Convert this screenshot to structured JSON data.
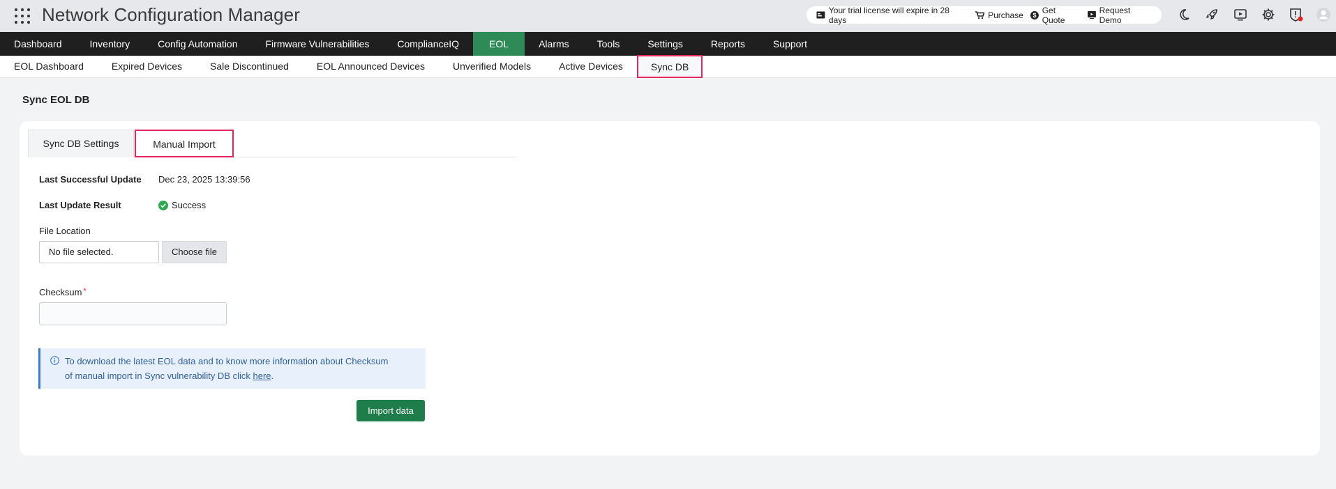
{
  "app": {
    "title": "Network Configuration Manager"
  },
  "header": {
    "trial_text": "Your trial license will expire in 28 days",
    "purchase": "Purchase",
    "get_quote": "Get Quote",
    "request_demo": "Request Demo",
    "icons": [
      "apps-grid-icon",
      "moon-icon",
      "rocket-icon",
      "video-icon",
      "gear-icon",
      "alert-shield-icon",
      "user-avatar-icon"
    ]
  },
  "mainnav": {
    "items": [
      "Dashboard",
      "Inventory",
      "Config Automation",
      "Firmware Vulnerabilities",
      "ComplianceIQ",
      "EOL",
      "Alarms",
      "Tools",
      "Settings",
      "Reports",
      "Support"
    ],
    "active": "EOL"
  },
  "subnav": {
    "items": [
      "EOL Dashboard",
      "Expired Devices",
      "Sale Discontinued",
      "EOL Announced Devices",
      "Unverified Models",
      "Active Devices",
      "Sync DB"
    ],
    "active": "Sync DB"
  },
  "page": {
    "title": "Sync EOL DB"
  },
  "tabs": {
    "sync_settings": "Sync DB Settings",
    "manual_import": "Manual Import",
    "active": "Manual Import"
  },
  "status": {
    "last_update_label": "Last Successful Update",
    "last_update_value": "Dec 23, 2025 13:39:56",
    "last_result_label": "Last Update Result",
    "last_result_value": "Success"
  },
  "file": {
    "label": "File Location",
    "value": "No file selected.",
    "button": "Choose file"
  },
  "checksum": {
    "label": "Checksum",
    "required_mark": "*",
    "value": ""
  },
  "info": {
    "line1": "To download the latest EOL data and to know more information about Checksum",
    "line2": "of manual import in Sync vulnerability DB click ",
    "link": "here",
    "end": "."
  },
  "actions": {
    "import": "Import data"
  },
  "colors": {
    "accent_green": "#2e8b57",
    "highlight_border": "#e6245e",
    "success": "#2fa84f",
    "info_blue": "#3b7bc8"
  }
}
